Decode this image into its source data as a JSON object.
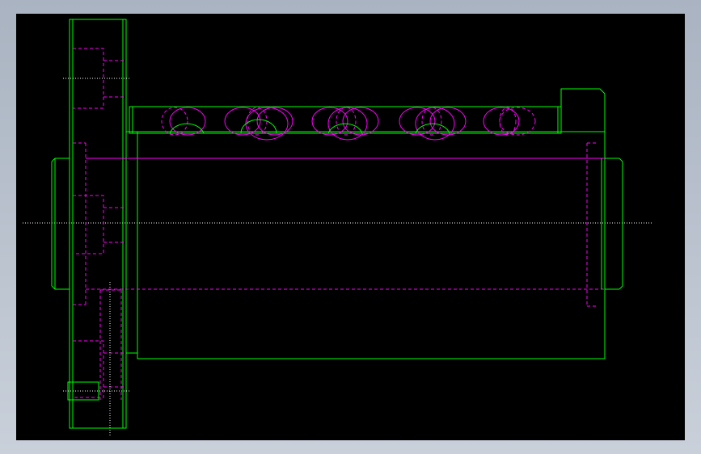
{
  "viewer": {
    "background": "#000000",
    "frame_color": "#aab4c2"
  },
  "colors": {
    "visible_edge": "#00ff00",
    "hidden_edge": "#ff00ff",
    "center_line": "#ffffff"
  },
  "drawing": {
    "part": "ball-spline-nut",
    "view": "side-elevation",
    "ball_circuits": 5
  }
}
